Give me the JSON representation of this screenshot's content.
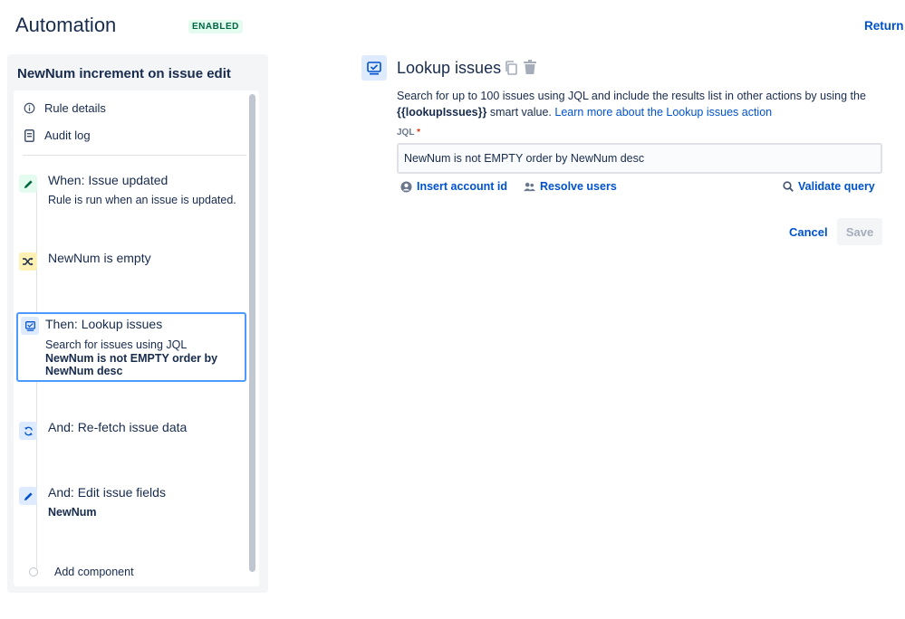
{
  "header": {
    "title": "Automation",
    "status": "ENABLED",
    "return_link": "Return t"
  },
  "sidebar": {
    "rule_name": "NewNum increment on issue edit",
    "nav": [
      {
        "label": "Rule details",
        "icon": "info-icon"
      },
      {
        "label": "Audit log",
        "icon": "audit-log-icon"
      }
    ],
    "components": [
      {
        "title": "When: Issue updated",
        "description": "Rule is run when an issue is updated.",
        "icon": "pencil-icon",
        "icon_color": "#006644"
      },
      {
        "title": "NewNum is empty",
        "icon": "shuffle-icon",
        "icon_color": "#172b4d"
      },
      {
        "title": "Then: Lookup issues",
        "description_prefix": "Search for issues using JQL",
        "description_bold": "NewNum is not EMPTY order by NewNum desc",
        "icon": "lookup-icon",
        "selected": true
      },
      {
        "title": "And: Re-fetch issue data",
        "icon": "refresh-icon"
      },
      {
        "title": "And: Edit issue fields",
        "description_bold": "NewNum",
        "icon": "pencil-icon"
      }
    ],
    "add_component": "Add component"
  },
  "main": {
    "heading": "Lookup issues",
    "description_pre": "Search for up to 100 issues using JQL and include the results list in other actions by using the",
    "description_smart": "{{lookupIssues}}",
    "description_mid": " smart value. ",
    "description_link": "Learn more about the Lookup issues action",
    "field_label": "JQL",
    "required_mark": "*",
    "jql_value": "NewNum is not EMPTY order by NewNum desc",
    "helpers": {
      "insert_account": "Insert account id",
      "resolve_users": "Resolve users",
      "validate_query": "Validate query"
    },
    "cancel_label": "Cancel",
    "save_label": "Save"
  },
  "colors": {
    "accent": "#0052cc",
    "selected_border": "#4c9aff",
    "enabled_bg": "#e3fcef",
    "enabled_text": "#006644"
  }
}
